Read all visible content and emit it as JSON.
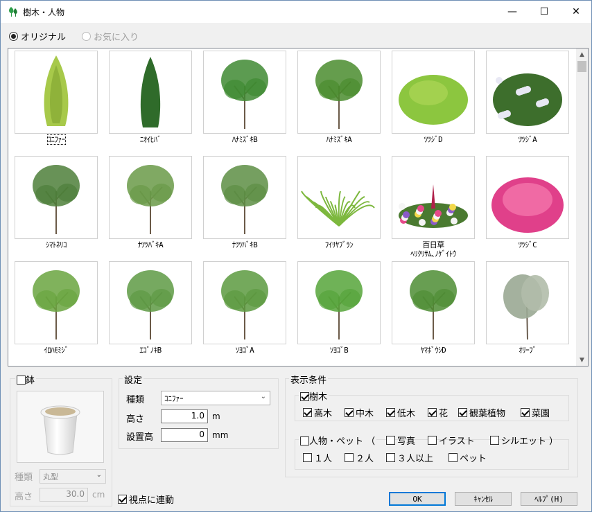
{
  "window": {
    "title": "樹木・人物",
    "minimize": "—",
    "maximize": "☐",
    "close": "✕"
  },
  "mode": {
    "original": {
      "label": "オリジナル",
      "selected": true
    },
    "favorites": {
      "label": "お気に入り",
      "selected": false,
      "disabled": true
    }
  },
  "gallery": {
    "items": [
      {
        "caption": "ｺﾆﾌｧｰ",
        "icon": "conifer-tree-image",
        "selected": true
      },
      {
        "caption": "ﾆｵｲﾋﾊﾞ",
        "icon": "columnar-tree-image"
      },
      {
        "caption": "ﾊﾅﾐｽﾞｷB",
        "icon": "dogwood-tree-image"
      },
      {
        "caption": "ﾊﾅﾐｽﾞｷA",
        "icon": "dogwood-tree-image"
      },
      {
        "caption": "ﾂﾂｼﾞD",
        "icon": "round-shrub-image"
      },
      {
        "caption": "ﾂﾂｼﾞA",
        "icon": "flowering-shrub-image"
      },
      {
        "caption": "ｼﾏﾄﾈﾘｺ",
        "icon": "ash-tree-image"
      },
      {
        "caption": "ﾅﾂﾂﾊﾞｷA",
        "icon": "camellia-tree-image"
      },
      {
        "caption": "ﾅﾂﾂﾊﾞｷB",
        "icon": "camellia-tree-image"
      },
      {
        "caption": "ﾌｲﾘﾔﾌﾞﾗﾝ",
        "icon": "grass-plant-image"
      },
      {
        "caption": "百日草",
        "caption2": "ﾍﾘｸﾘｻﾑ､ﾉｹﾞｲﾄｳ",
        "icon": "flower-bed-image"
      },
      {
        "caption": "ﾂﾂｼﾞC",
        "icon": "pink-azalea-image"
      },
      {
        "caption": "ｲﾛﾊﾓﾐｼﾞ",
        "icon": "maple-tree-image"
      },
      {
        "caption": "ｴｺﾞﾉｷB",
        "icon": "snowbell-tree-image"
      },
      {
        "caption": "ｿﾖｺﾞA",
        "icon": "soyogo-tree-image"
      },
      {
        "caption": "ｿﾖｺﾞB",
        "icon": "soyogo-tree-image"
      },
      {
        "caption": "ﾔﾏﾎﾞｳｼD",
        "icon": "yamaboushi-tree-image"
      },
      {
        "caption": "ｵﾘｰﾌﾞ",
        "icon": "olive-tree-image"
      }
    ]
  },
  "pot": {
    "checkbox_label": "鉢",
    "checked": false,
    "type_label": "種類",
    "type_value": "丸型",
    "height_label": "高さ",
    "height_value": "30.0",
    "height_unit": "cm"
  },
  "settings": {
    "title": "設定",
    "type_label": "種類",
    "type_value": "ｺﾆﾌｧｰ",
    "height_label": "高さ",
    "height_value": "1.0",
    "height_unit": "m",
    "elevation_label": "設置高",
    "elevation_value": "0",
    "elevation_unit": "mm"
  },
  "display": {
    "title": "表示条件",
    "trees": {
      "label": "樹木",
      "checked": true,
      "items": [
        {
          "label": "高木",
          "checked": true
        },
        {
          "label": "中木",
          "checked": true
        },
        {
          "label": "低木",
          "checked": true
        },
        {
          "label": "花",
          "checked": true
        },
        {
          "label": "観葉植物",
          "checked": true
        },
        {
          "label": "菜園",
          "checked": true
        }
      ]
    },
    "people": {
      "label": "人物・ペット （",
      "checked": false,
      "style_items": [
        {
          "label": "写真",
          "checked": false
        },
        {
          "label": "イラスト",
          "checked": false
        },
        {
          "label": "シルエット ）",
          "checked": false
        }
      ],
      "count_items": [
        {
          "label": "１人",
          "checked": false
        },
        {
          "label": "２人",
          "checked": false
        },
        {
          "label": "３人以上",
          "checked": false
        },
        {
          "label": "ペット",
          "checked": false
        }
      ]
    }
  },
  "viewpoint": {
    "label": "視点に連動",
    "checked": true
  },
  "buttons": {
    "ok": "OK",
    "cancel": "ｷｬﾝｾﾙ",
    "help": "ﾍﾙﾌﾟ(H)"
  },
  "scrollbar": {
    "up": "▲",
    "down": "▼"
  }
}
